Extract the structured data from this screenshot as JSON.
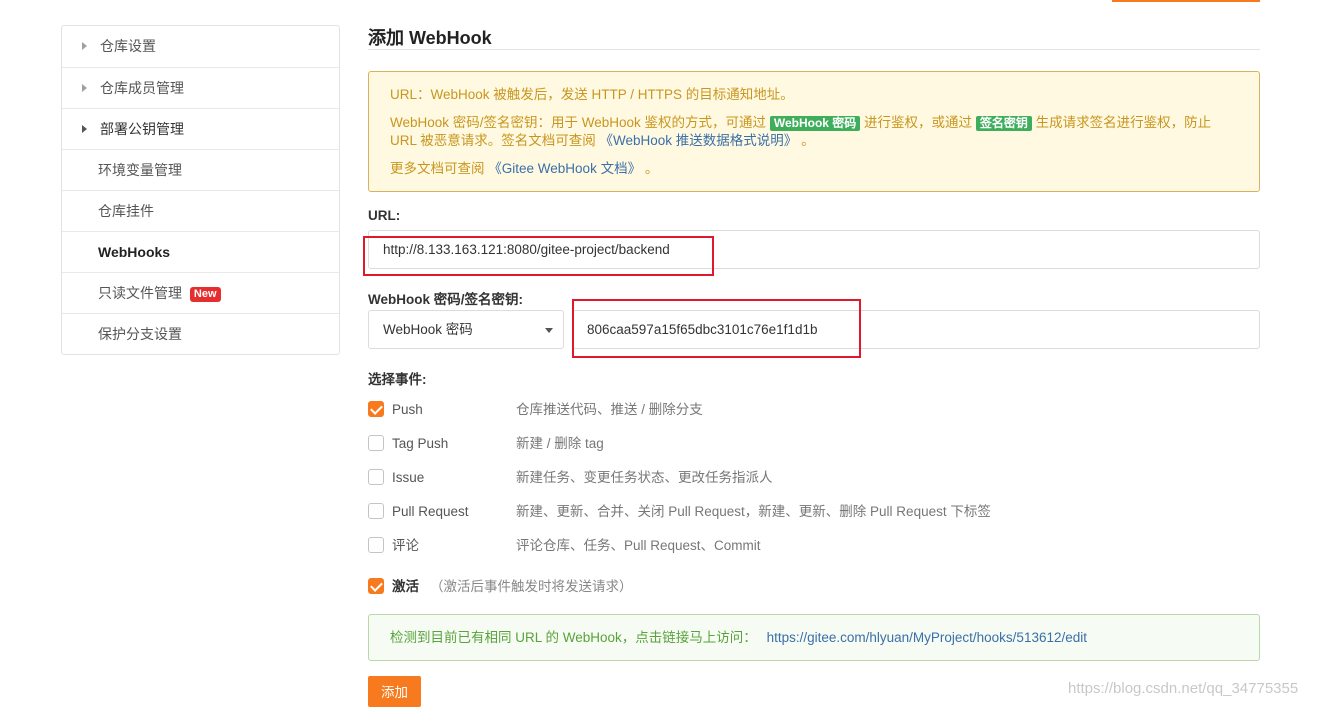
{
  "sidebar": {
    "items": [
      {
        "label": "仓库设置"
      },
      {
        "label": "仓库成员管理"
      },
      {
        "label": "部署公钥管理"
      },
      {
        "label": "环境变量管理"
      },
      {
        "label": "仓库挂件"
      },
      {
        "label": "WebHooks"
      },
      {
        "label": "只读文件管理",
        "badge": "New"
      },
      {
        "label": "保护分支设置"
      }
    ]
  },
  "main": {
    "title": "添加 WebHook",
    "notice": {
      "line1": "URL：WebHook 被触发后，发送 HTTP / HTTPS 的目标通知地址。",
      "line2_a": "WebHook 密码/签名密钥：用于 WebHook 鉴权的方式，可通过",
      "chip1": "WebHook 密码",
      "line2_b": "进行鉴权，或通过",
      "chip2": "签名密钥",
      "line2_c": "生成请求签名进行鉴权，防止 URL 被恶意请求。签名文档可查阅",
      "link1": "《WebHook 推送数据格式说明》",
      "line2_d": "。",
      "line3_a": "更多文档可查阅",
      "link2": "《Gitee WebHook 文档》",
      "line3_b": "。"
    },
    "url": {
      "label": "URL:",
      "value": "http://8.133.163.121:8080/gitee-project/backend"
    },
    "secret": {
      "label": "WebHook 密码/签名密钥:",
      "type_selected": "WebHook 密码",
      "value": "806caa597a15f65dbc3101c76e1f1d1b"
    },
    "events": {
      "label": "选择事件:",
      "items": [
        {
          "name": "Push",
          "desc": "仓库推送代码、推送 / 删除分支",
          "checked": true
        },
        {
          "name": "Tag Push",
          "desc": "新建 / 删除 tag",
          "checked": false
        },
        {
          "name": "Issue",
          "desc": "新建任务、变更任务状态、更改任务指派人",
          "checked": false
        },
        {
          "name": "Pull Request",
          "desc": "新建、更新、合并、关闭 Pull Request，新建、更新、删除 Pull Request 下标签",
          "checked": false
        },
        {
          "name": "评论",
          "desc": "评论仓库、任务、Pull Request、Commit",
          "checked": false
        }
      ]
    },
    "activate": {
      "label": "激活",
      "hint": "（激活后事件触发时将发送请求）",
      "checked": true
    },
    "existing": {
      "text": "检测到目前已有相同 URL 的 WebHook，点击链接马上访问：",
      "link": "https://gitee.com/hlyuan/MyProject/hooks/513612/edit"
    },
    "submit_label": "添加"
  },
  "watermark": "https://blog.csdn.net/qq_34775355",
  "colors": {
    "accent": "#f77b1e",
    "annotation": "#e0182d",
    "notice_text": "#c8961f",
    "success_text": "#58a33c",
    "badge": "#e52e2e"
  }
}
